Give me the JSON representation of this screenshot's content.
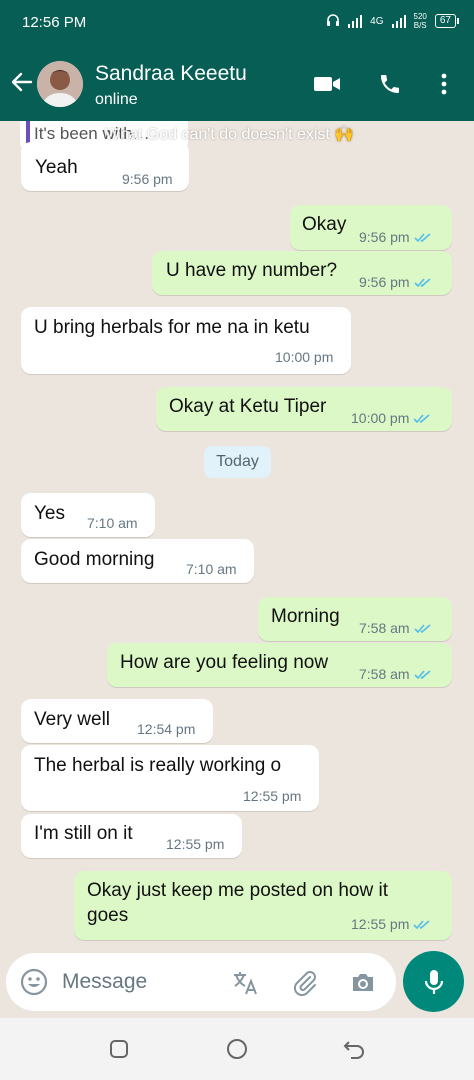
{
  "status_bar": {
    "time": "12:56 PM",
    "network": "4G",
    "speed_value": "520",
    "speed_unit": "B/S",
    "battery": "67"
  },
  "header": {
    "contact_name": "Sandraa Keeetu",
    "contact_status": "online",
    "icons": [
      "back-arrow-icon",
      "video-call-icon",
      "phone-icon",
      "more-vertical-icon"
    ]
  },
  "chat": {
    "pinned_fragment": "It's been with…",
    "overlay_caption": "What God can't do doesn't exist 🙌",
    "date_chip": "Today",
    "messages": [
      {
        "dir": "in",
        "text": "Yeah",
        "time": "9:56 pm"
      },
      {
        "dir": "out",
        "text": "Okay",
        "time": "9:56 pm",
        "status": "read"
      },
      {
        "dir": "out",
        "text": "U have my number?",
        "time": "9:56 pm",
        "status": "read"
      },
      {
        "dir": "in",
        "text": "U bring herbals for me na in ketu",
        "time": "10:00 pm"
      },
      {
        "dir": "out",
        "text": "Okay at Ketu Tiper",
        "time": "10:00 pm",
        "status": "read"
      },
      {
        "dir": "in",
        "text": "Yes",
        "time": "7:10 am"
      },
      {
        "dir": "in",
        "text": "Good morning",
        "time": "7:10 am"
      },
      {
        "dir": "out",
        "text": "Morning",
        "time": "7:58 am",
        "status": "read"
      },
      {
        "dir": "out",
        "text": "How are you feeling now",
        "time": "7:58 am",
        "status": "read"
      },
      {
        "dir": "in",
        "text": "Very well",
        "time": "12:54 pm"
      },
      {
        "dir": "in",
        "text": "The herbal is really working o",
        "time": "12:55 pm"
      },
      {
        "dir": "in",
        "text": "I'm still on it",
        "time": "12:55 pm"
      },
      {
        "dir": "out",
        "text": "Okay just keep me posted on how it",
        "text2": "goes",
        "time": "12:55 pm",
        "status": "read"
      }
    ]
  },
  "composer": {
    "placeholder": "Message",
    "icons": [
      "emoji-icon",
      "translate-icon",
      "attach-icon",
      "camera-icon",
      "mic-icon"
    ]
  },
  "colors": {
    "header": "#075e54",
    "incoming_bubble": "#ffffff",
    "outgoing_bubble": "#dcf8c6",
    "read_tick": "#53bdeb",
    "mic_button": "#00897b",
    "chat_background": "#ece5dd"
  }
}
